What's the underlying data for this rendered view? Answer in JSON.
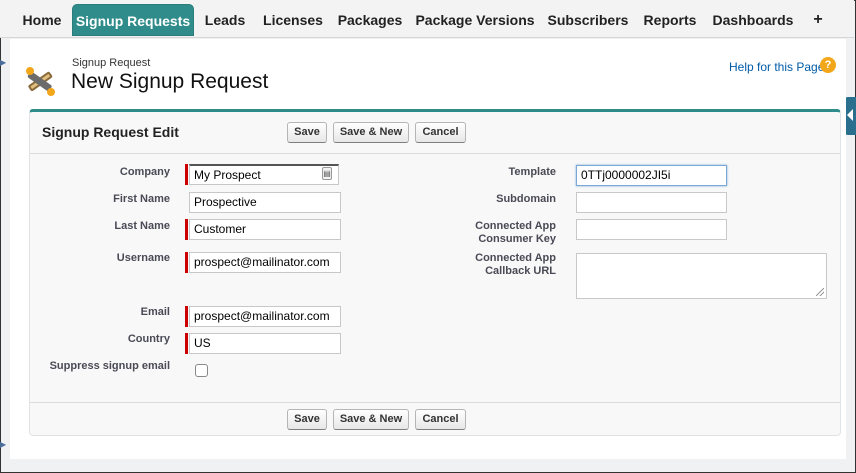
{
  "tabs": [
    {
      "label": "Home",
      "active": false
    },
    {
      "label": "Signup Requests",
      "active": true
    },
    {
      "label": "Leads",
      "active": false
    },
    {
      "label": "Licenses",
      "active": false
    },
    {
      "label": "Packages",
      "active": false
    },
    {
      "label": "Package Versions",
      "active": false
    },
    {
      "label": "Subscribers",
      "active": false
    },
    {
      "label": "Reports",
      "active": false
    },
    {
      "label": "Dashboards",
      "active": false
    },
    {
      "label": "+",
      "active": false
    }
  ],
  "header": {
    "breadcrumb": "Signup Request",
    "title": "New Signup Request",
    "help_link": "Help for this Page",
    "help_icon": "?"
  },
  "panel": {
    "title": "Signup Request Edit",
    "buttons": {
      "save": "Save",
      "save_new": "Save & New",
      "cancel": "Cancel"
    }
  },
  "form": {
    "company": {
      "label": "Company",
      "value": "My Prospect",
      "required": true
    },
    "first_name": {
      "label": "First Name",
      "value": "Prospective",
      "required": false
    },
    "last_name": {
      "label": "Last Name",
      "value": "Customer",
      "required": true
    },
    "username": {
      "label": "Username",
      "value": "prospect@mailinator.com",
      "required": true
    },
    "email": {
      "label": "Email",
      "value": "prospect@mailinator.com",
      "required": true
    },
    "country": {
      "label": "Country",
      "value": "US",
      "required": true
    },
    "suppress_email": {
      "label": "Suppress signup email",
      "checked": false
    },
    "template": {
      "label": "Template",
      "value": "0TTj0000002JI5i"
    },
    "subdomain": {
      "label": "Subdomain",
      "value": ""
    },
    "consumer_key": {
      "label_line1": "Connected App",
      "label_line2": "Consumer Key",
      "value": ""
    },
    "callback_url": {
      "label_line1": "Connected App",
      "label_line2": "Callback URL",
      "value": ""
    }
  },
  "colors": {
    "accent": "#2f8c8a",
    "required": "#cc0000",
    "link": "#015ba7",
    "help_icon": "#f2a71b"
  }
}
